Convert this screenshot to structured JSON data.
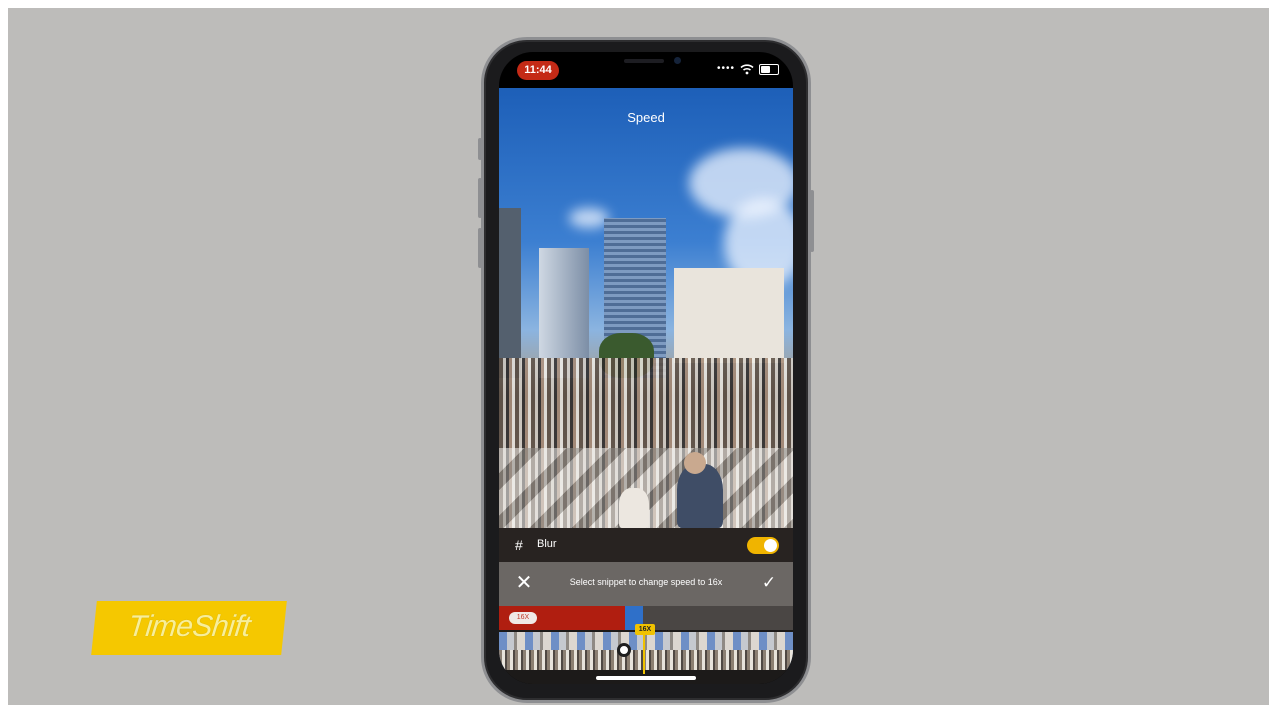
{
  "brand": {
    "logo_text": "TimeShift"
  },
  "status_bar": {
    "time": "11:44",
    "signal_icon": "cellular-dots-icon",
    "wifi_icon": "wifi-icon",
    "battery_icon": "battery-icon"
  },
  "screen": {
    "title": "Speed",
    "blur": {
      "label": "Blur",
      "icon": "grid-icon",
      "enabled": true
    },
    "action_bar": {
      "hint": "Select snippet to change speed to 16x",
      "close_icon": "close-icon",
      "confirm_icon": "check-icon"
    },
    "timeline": {
      "snippet_badge": "16X",
      "playhead_badge": "16X"
    }
  },
  "colors": {
    "accent_red": "#c42a16",
    "accent_yellow": "#f0c200",
    "brand_yellow": "#f5c800",
    "background": "#bdbcba"
  }
}
